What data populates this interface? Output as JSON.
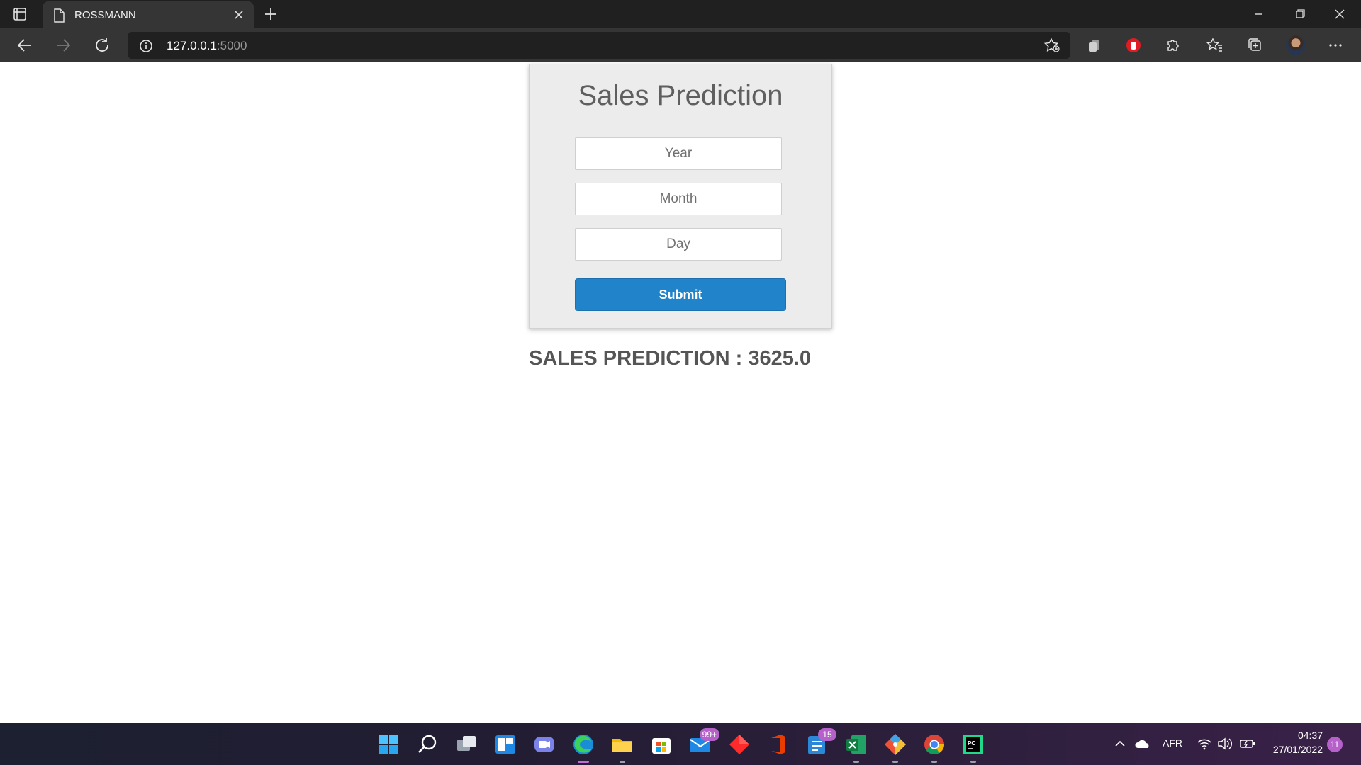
{
  "browser": {
    "tab_title": "ROSSMANN",
    "url_host": "127.0.0.1",
    "url_port": ":5000"
  },
  "form": {
    "title": "Sales Prediction",
    "year_placeholder": "Year",
    "month_placeholder": "Month",
    "day_placeholder": "Day",
    "submit_label": "Submit"
  },
  "result": {
    "text": "SALES PREDICTION : 3625.0"
  },
  "taskbar": {
    "mail_badge": "99+",
    "todo_badge": "15",
    "language": "AFR",
    "time": "04:37",
    "date": "27/01/2022",
    "notifications": "11"
  },
  "colors": {
    "accent": "#2183c9",
    "card_bg": "#ececec",
    "text_gray": "#555555"
  },
  "icons": [
    "tab-actions-icon",
    "page-icon",
    "close-icon",
    "plus-icon",
    "minimize-icon",
    "restore-icon",
    "back-icon",
    "forward-icon",
    "refresh-icon",
    "info-icon",
    "add-favorite-icon",
    "extension-icons",
    "favorites-icon",
    "collections-icon",
    "more-icon",
    "windows-start-icon",
    "search-icon",
    "task-view-icon",
    "widgets-icon",
    "chat-icon",
    "edge-icon",
    "file-explorer-icon",
    "store-icon",
    "mail-icon",
    "red-diamond-icon",
    "office-icon",
    "todo-icon",
    "excel-icon",
    "git-icon",
    "chrome-icon",
    "pycharm-icon",
    "chevron-up-icon",
    "onedrive-icon",
    "wifi-icon",
    "volume-icon",
    "battery-icon"
  ]
}
